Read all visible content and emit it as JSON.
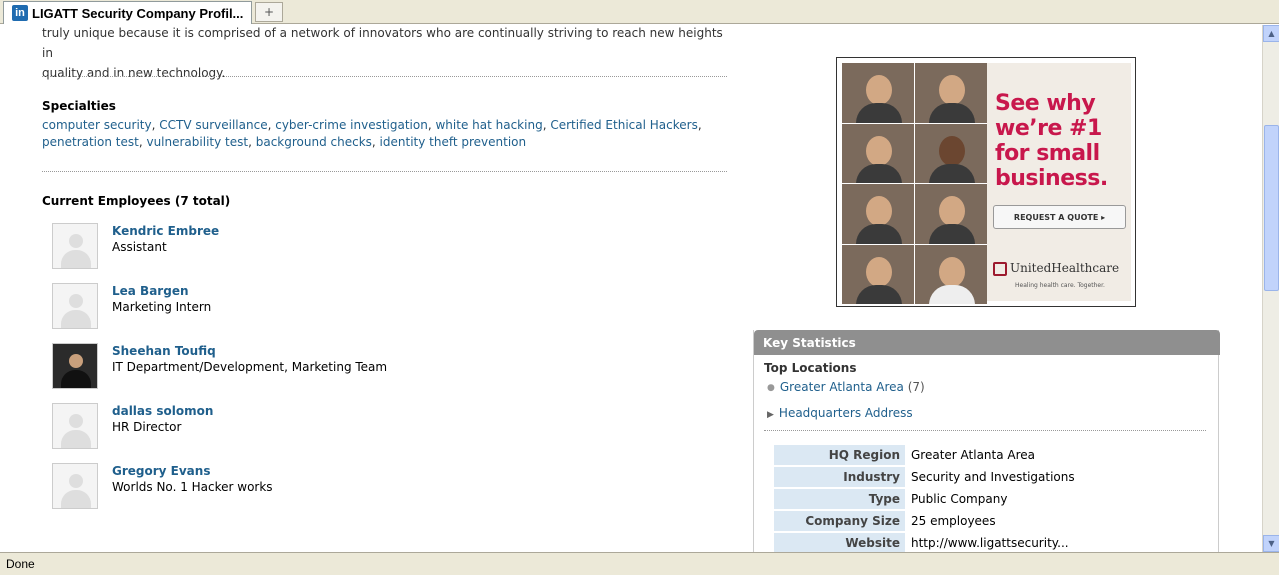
{
  "tab": {
    "title": "LIGATT Security Company Profil...",
    "icon": "linkedin-icon",
    "icon_text": "in",
    "new_tab_symbol": "+"
  },
  "description": {
    "line1": "truly unique because it is comprised of a network of innovators who are continually striving to reach new heights in",
    "line2": "quality and in new technology."
  },
  "specialties": {
    "title": "Specialties",
    "items": [
      "computer security",
      "CCTV surveillance",
      "cyber-crime investigation",
      "white hat hacking",
      "Certified Ethical Hackers",
      "penetration test",
      "vulnerability test",
      "background checks",
      "identity theft prevention"
    ]
  },
  "employees": {
    "title": "Current Employees (7 total)",
    "list": [
      {
        "name": "Kendric Embree",
        "title": "Assistant"
      },
      {
        "name": "Lea Bargen",
        "title": "Marketing Intern"
      },
      {
        "name": "Sheehan Toufiq",
        "title": "IT Department/Development, Marketing Team"
      },
      {
        "name": "dallas solomon",
        "title": "HR Director"
      },
      {
        "name": "Gregory Evans",
        "title": "Worlds No. 1 Hacker works"
      }
    ]
  },
  "ad": {
    "headline": "See why we’re #1 for small business.",
    "button": "REQUEST A QUOTE ▸",
    "brand": "UnitedHealthcare",
    "tagline": "Healing health care. Together."
  },
  "key_statistics": {
    "header": "Key Statistics",
    "top_locations_label": "Top Locations",
    "location": {
      "name": "Greater Atlanta Area",
      "count": "(7)"
    },
    "hq_link": "Headquarters Address",
    "rows": [
      {
        "label": "HQ Region",
        "value": "Greater Atlanta Area",
        "link": false
      },
      {
        "label": "Industry",
        "value": "Security and Investigations",
        "link": true
      },
      {
        "label": "Type",
        "value": "Public Company",
        "link": false
      },
      {
        "label": "Company Size",
        "value": "25 employees",
        "link": false
      },
      {
        "label": "Website",
        "value": "http://www.ligattsecurity...",
        "link": true
      }
    ]
  },
  "status": {
    "text": "Done"
  }
}
